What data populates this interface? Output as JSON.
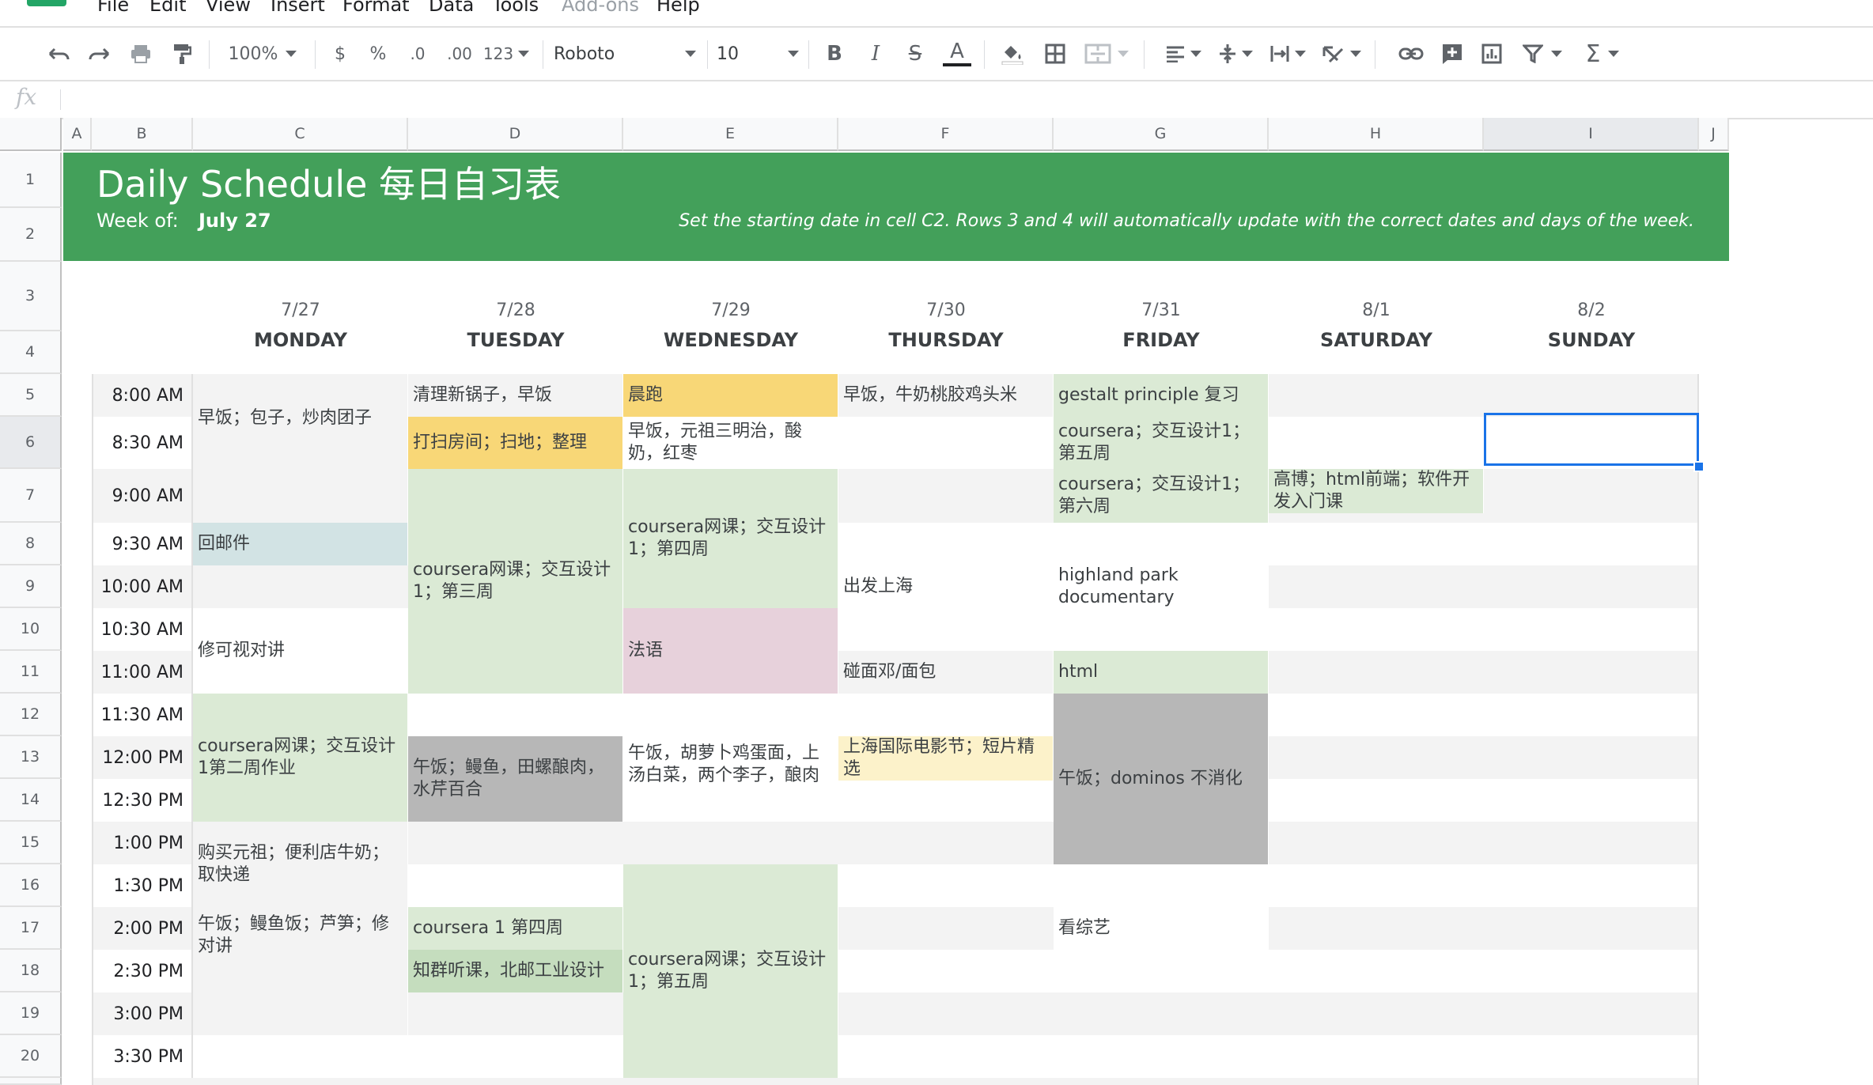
{
  "menu": {
    "items": [
      "File",
      "Edit",
      "View",
      "Insert",
      "Format",
      "Data",
      "Tools",
      "Add-ons",
      "Help"
    ]
  },
  "toolbar": {
    "zoom": "100%",
    "currency": "$",
    "percent": "%",
    "decrease_decimals": ".0",
    "increase_decimals": ".00",
    "more_formats": "123",
    "font": "Roboto",
    "font_size": "10",
    "bold": "B",
    "italic": "I",
    "strike": "S",
    "text_color": "A",
    "sum": "Σ"
  },
  "formula_bar": {
    "fx_label": "fx",
    "value": ""
  },
  "columns": [
    "A",
    "B",
    "C",
    "D",
    "E",
    "F",
    "G",
    "H",
    "I",
    "J"
  ],
  "rows": [
    "1",
    "2",
    "3",
    "4",
    "5",
    "6",
    "7",
    "8",
    "9",
    "10",
    "11",
    "12",
    "13",
    "14",
    "15",
    "16",
    "17",
    "18",
    "19",
    "20"
  ],
  "banner": {
    "title": "Daily Schedule 每日自习表",
    "week_label": "Week of:",
    "week_value": "July 27",
    "note": "Set the starting date in cell C2. Rows 3 and 4 will automatically update with the correct dates and days of the week."
  },
  "days": [
    {
      "date": "7/27",
      "name": "MONDAY"
    },
    {
      "date": "7/28",
      "name": "TUESDAY"
    },
    {
      "date": "7/29",
      "name": "WEDNESDAY"
    },
    {
      "date": "7/30",
      "name": "THURSDAY"
    },
    {
      "date": "7/31",
      "name": "FRIDAY"
    },
    {
      "date": "8/1",
      "name": "SATURDAY"
    },
    {
      "date": "8/2",
      "name": "SUNDAY"
    }
  ],
  "times": [
    "8:00 AM",
    "8:30 AM",
    "9:00 AM",
    "9:30 AM",
    "10:00 AM",
    "10:30 AM",
    "11:00 AM",
    "11:30 AM",
    "12:00 PM",
    "12:30 PM",
    "1:00 PM",
    "1:30 PM",
    "2:00 PM",
    "2:30 PM",
    "3:00 PM",
    "3:30 PM"
  ],
  "schedule": {
    "monday": [
      "早饭；包子，炒肉团子",
      "回邮件",
      "修可视对讲",
      "coursera网课；交互设计1第二周作业",
      "购买元祖；便利店牛奶；取快递",
      "午饭；鳗鱼饭；芦笋；修对讲"
    ],
    "tuesday": [
      "清理新锅子，早饭",
      "打扫房间；扫地；整理",
      "coursera网课；交互设计1；第三周",
      "午饭；鳗鱼，田螺酿肉，水芹百合",
      "coursera 1 第四周",
      "知群听课，北邮工业设计"
    ],
    "wednesday": [
      "晨跑",
      "早饭，元祖三明治，酸奶，红枣",
      "coursera网课；交互设计1；第四周",
      "法语",
      "午饭，胡萝卜鸡蛋面，上汤白菜，两个李子，酿肉",
      "coursera网课；交互设计1；第五周"
    ],
    "thursday": [
      "早饭，牛奶桃胶鸡头米",
      "出发上海",
      "碰面邓/面包",
      "上海国际电影节；短片精选"
    ],
    "friday": [
      "gestalt principle 复习",
      "coursera；交互设计1；第五周",
      "coursera；交互设计1；第六周",
      "highland park documentary",
      "html",
      "午饭；dominos 不消化",
      "看综艺"
    ],
    "saturday": [
      "高博；html前端；软件开发入门课"
    ]
  },
  "colors": {
    "banner": "#43a05a",
    "green_block": "#dbead5",
    "yellow_block": "#f8d777",
    "light_yellow_block": "#fcf2ca",
    "gray_block": "#b7b7b7",
    "pink_block": "#e7d1db",
    "blue_block": "#c9daf8",
    "teal_block": "#d2e3e4",
    "selection": "#1a73e8"
  }
}
